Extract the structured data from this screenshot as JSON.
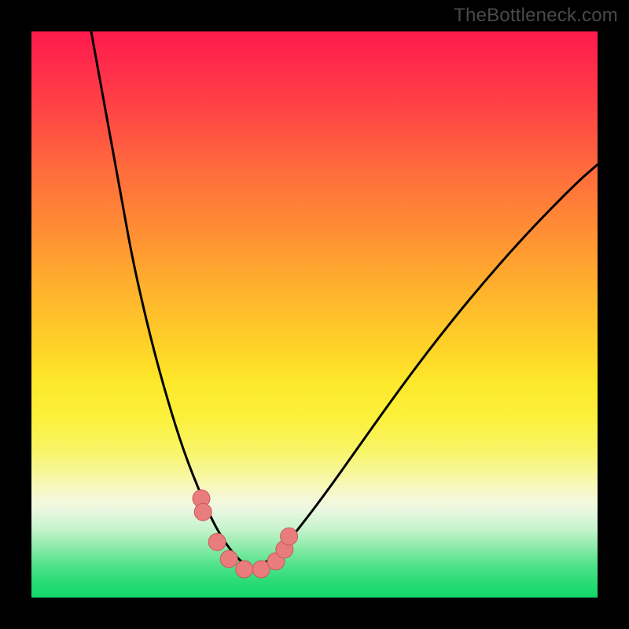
{
  "watermark": {
    "text": "TheBottleneck.com"
  },
  "colors": {
    "background": "#000000",
    "curve_stroke": "#000000",
    "marker_fill": "#e97c7c",
    "marker_stroke": "#c85b5b",
    "gradient_top": "#ff1a4d",
    "gradient_bottom": "#11d86a"
  },
  "chart_data": {
    "type": "line",
    "title": "",
    "xlabel": "",
    "ylabel": "",
    "xlim": [
      0,
      100
    ],
    "ylim": [
      0,
      100
    ],
    "grid": false,
    "legend": false,
    "note": "x/y as percent of 720×720 plot area, y=0 at top. Left curve starts upper-left and plunges to a minimum near x≈38; right curve rises from the minimum toward upper-right. Discrete markers sit along the flat bottom.",
    "series": [
      {
        "name": "curve-left",
        "x": [
          10.0,
          12.0,
          14.0,
          16.0,
          18.0,
          21.0,
          24.0,
          27.0,
          30.0,
          32.0,
          34.0,
          36.0,
          37.5,
          39.0
        ],
        "y": [
          -3.0,
          8.0,
          19.0,
          30.0,
          41.0,
          54.0,
          65.0,
          74.5,
          82.0,
          86.5,
          90.0,
          92.6,
          94.0,
          94.8
        ]
      },
      {
        "name": "curve-right",
        "x": [
          39.0,
          40.5,
          42.5,
          45.0,
          48.0,
          52.0,
          57.0,
          63.0,
          70.0,
          78.0,
          87.0,
          96.0,
          100.0
        ],
        "y": [
          94.8,
          94.3,
          93.0,
          90.5,
          86.8,
          81.5,
          74.5,
          66.0,
          56.5,
          46.5,
          36.2,
          27.0,
          23.5
        ]
      },
      {
        "name": "markers",
        "x": [
          30.0,
          30.3,
          32.8,
          34.9,
          37.6,
          40.6,
          43.2,
          44.7,
          45.5
        ],
        "y": [
          82.5,
          84.9,
          90.2,
          93.2,
          95.0,
          95.0,
          93.6,
          91.5,
          89.2
        ]
      }
    ]
  }
}
